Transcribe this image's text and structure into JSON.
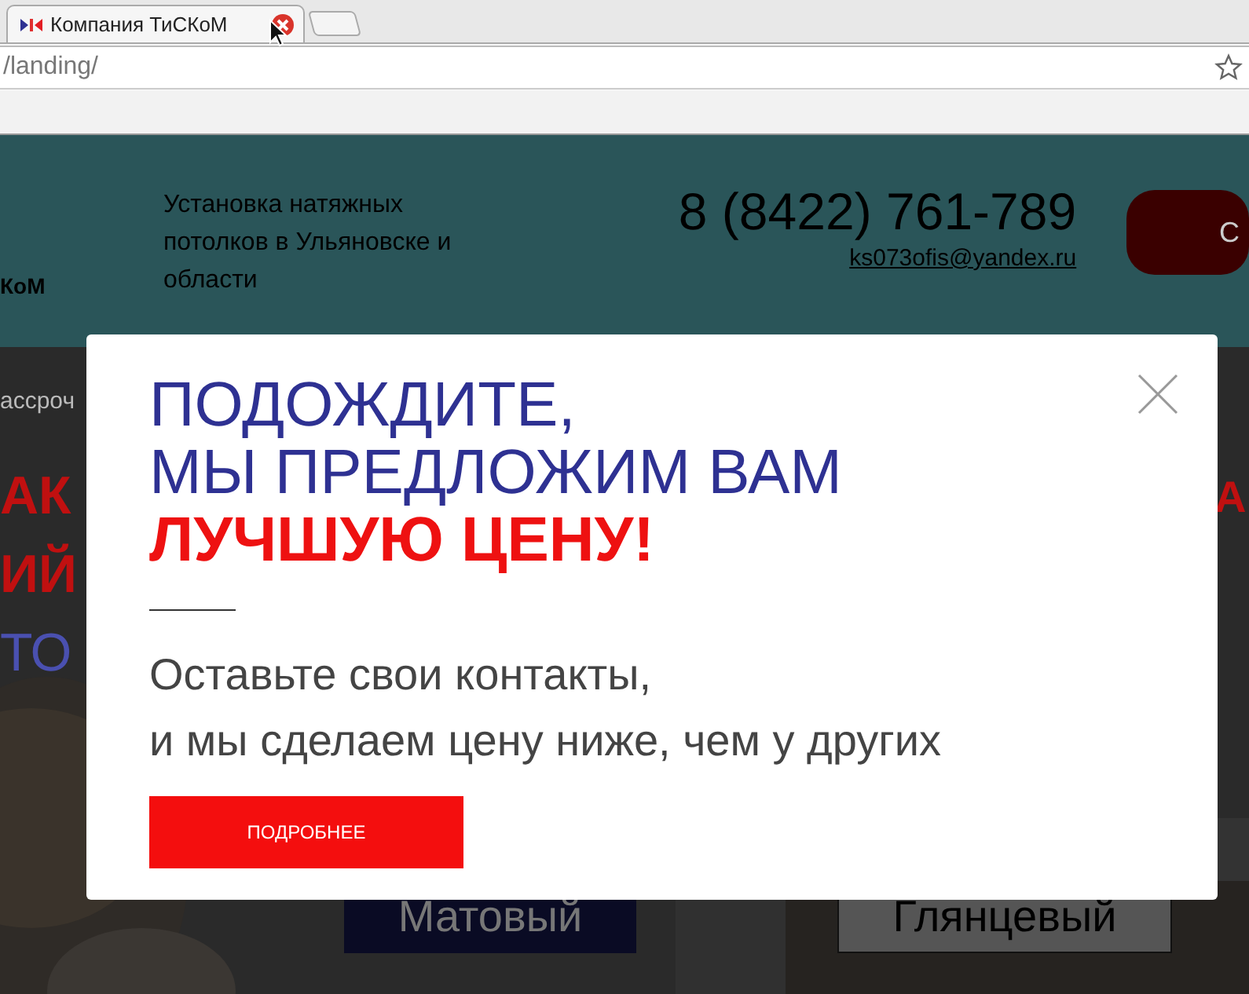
{
  "browser": {
    "tab_title": "Компания ТиСКоМ",
    "url": "/landing/"
  },
  "header": {
    "logo_text": "КоМ",
    "tagline": "Установка натяжных потолков в Ульяновске и области",
    "phone_prefix": "8 (8422)",
    "phone_number": "761-789",
    "email": "ks073ofis@yandex.ru",
    "cta_text": "С"
  },
  "hero": {
    "note": "ассроч",
    "headline_lines": [
      {
        "text": "АК",
        "color": "#c01010"
      },
      {
        "text": "ИЙ",
        "color": "#c01010"
      },
      {
        "text": "ТО",
        "color": "#4a50b0"
      }
    ],
    "side_text": "А",
    "buttons": [
      {
        "label": "Матовый",
        "kind": "filled"
      },
      {
        "label": "Глянцевый",
        "kind": "outlined"
      }
    ]
  },
  "modal": {
    "title_lines": [
      {
        "text": "ПОДОЖДИТЕ,",
        "kind": "normal"
      },
      {
        "text": "МЫ ПРЕДЛОЖИМ ВАМ",
        "kind": "normal"
      },
      {
        "text": "ЛУЧШУЮ ЦЕНУ!",
        "kind": "highlight"
      }
    ],
    "subtitle_lines": [
      "Оставьте свои контакты,",
      "и мы сделаем цену ниже, чем у других"
    ],
    "button": "ПОДРОБНЕЕ"
  }
}
